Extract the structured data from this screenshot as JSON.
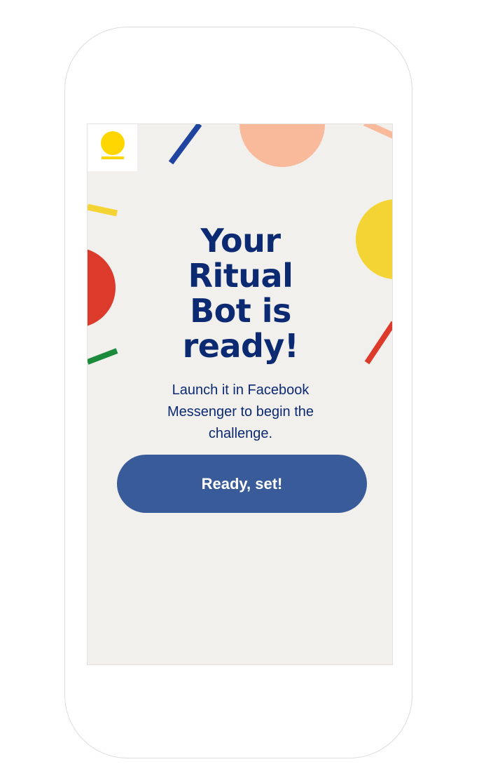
{
  "hero": {
    "title_lines": [
      "Your",
      "Ritual",
      "Bot is",
      "ready!"
    ],
    "subtitle": "Launch it in Facebook Messenger to begin the challenge."
  },
  "cta": {
    "label": "Ready, set!"
  },
  "colors": {
    "background": "#f2f0ed",
    "heading": "#0c2a72",
    "button": "#3a5b9a",
    "logo": "#ffd600",
    "peach": "#f9b99b",
    "yellow": "#f4d434",
    "red": "#dc3a2a",
    "blue": "#1f44a0",
    "green": "#1b8a3a"
  },
  "icons": {
    "logo": "ritual-logo-icon"
  }
}
